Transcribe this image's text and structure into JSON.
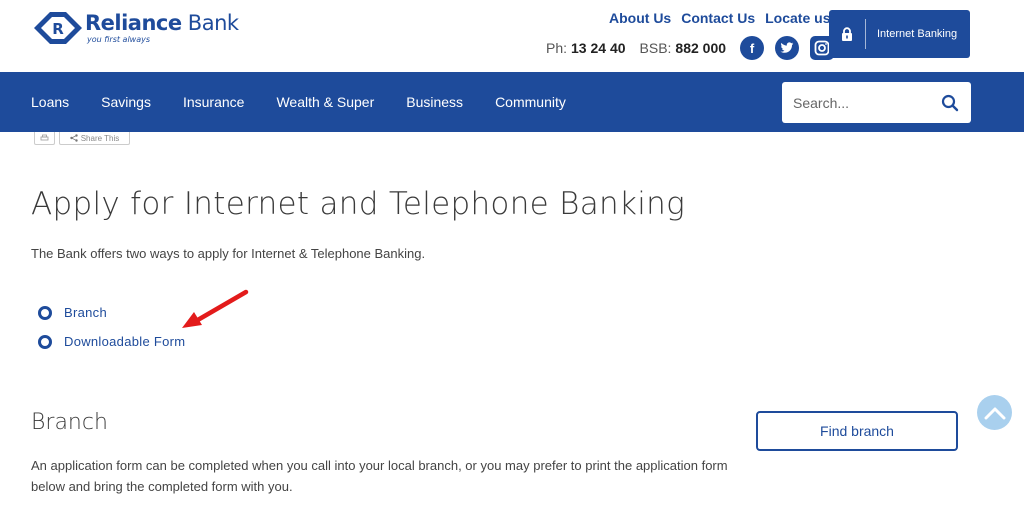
{
  "brand": {
    "name_bold": "Reliance",
    "name_light": " Bank",
    "tagline": "you first always"
  },
  "top_links": [
    "About Us",
    "Contact Us",
    "Locate us"
  ],
  "contact": {
    "phone_label": "Ph:",
    "phone": "13 24 40",
    "bsb_label": "BSB:",
    "bsb": "882 000"
  },
  "social": {
    "facebook": "f",
    "twitter": "twitter-icon",
    "instagram": "instagram-icon"
  },
  "internet_banking_label": "Internet Banking",
  "nav": [
    "Loans",
    "Savings",
    "Insurance",
    "Wealth & Super",
    "Business",
    "Community"
  ],
  "search": {
    "placeholder": "Search..."
  },
  "utility": {
    "share_label": "Share This"
  },
  "page": {
    "title": "Apply for Internet and Telephone Banking",
    "intro": "The Bank offers two ways to apply for Internet & Telephone Banking.",
    "options": [
      "Branch",
      "Downloadable Form"
    ]
  },
  "branch_section": {
    "title": "Branch",
    "text": "An application form can be completed when you call into your local branch, or you may prefer to print the application form below and bring the completed form with you.",
    "button": "Find branch"
  },
  "colors": {
    "brand_blue": "#1e4b9b",
    "annotation_red": "#e31b1b",
    "back_to_top": "#a9d0ee"
  }
}
